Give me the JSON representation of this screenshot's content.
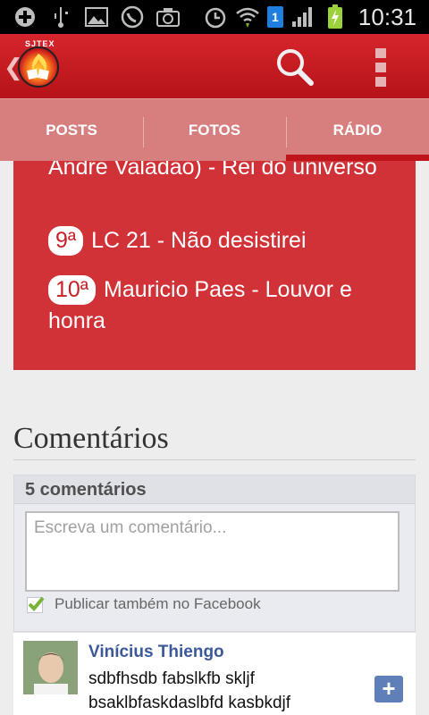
{
  "status_bar": {
    "time": "10:31",
    "notification_badge": "1",
    "icons": [
      "add-icon",
      "usb-icon",
      "image-icon",
      "whatsapp-icon",
      "camera-icon",
      "alarm-icon",
      "wifi-icon",
      "notification-badge-icon",
      "signal-icon",
      "battery-charging-icon"
    ]
  },
  "action_bar": {
    "logo_text": "SJTEX",
    "accent": "#c8161b"
  },
  "tabs": [
    {
      "label": "POSTS",
      "active": false
    },
    {
      "label": "FOTOS",
      "active": false
    },
    {
      "label": "RÁDIO",
      "active": true
    }
  ],
  "radio": {
    "partial_top": "André Valadão) - Rei do universo",
    "items": [
      {
        "rank": "9ª",
        "title": "LC 21 - Não desistirei"
      },
      {
        "rank": "10ª",
        "title": "Mauricio Paes - Louvor e honra"
      }
    ]
  },
  "comments": {
    "heading": "Comentários",
    "count": "5 comentários",
    "input_placeholder": "Escreva um comentário...",
    "publish_facebook_label": "Publicar também no Facebook",
    "publish_facebook_checked": true,
    "list": [
      {
        "author": "Vinícius Thiengo",
        "text": "sdbfhsdb fabslkfb skljf bsaklbfaskdaslbfd kasbkdjf"
      }
    ]
  }
}
